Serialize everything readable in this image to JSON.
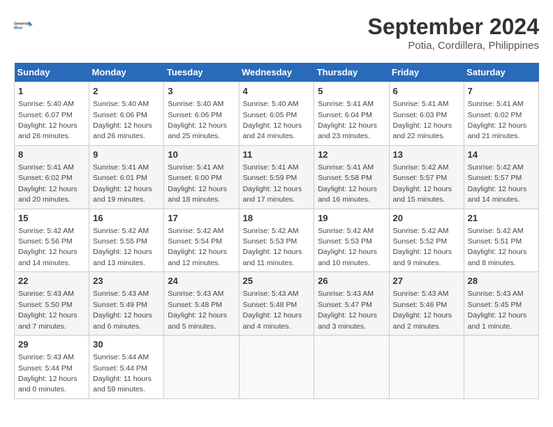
{
  "logo": {
    "line1": "General",
    "line2": "Blue"
  },
  "title": "September 2024",
  "location": "Potia, Cordillera, Philippines",
  "weekdays": [
    "Sunday",
    "Monday",
    "Tuesday",
    "Wednesday",
    "Thursday",
    "Friday",
    "Saturday"
  ],
  "weeks": [
    [
      {
        "day": "1",
        "info": "Sunrise: 5:40 AM\nSunset: 6:07 PM\nDaylight: 12 hours\nand 26 minutes."
      },
      {
        "day": "2",
        "info": "Sunrise: 5:40 AM\nSunset: 6:06 PM\nDaylight: 12 hours\nand 26 minutes."
      },
      {
        "day": "3",
        "info": "Sunrise: 5:40 AM\nSunset: 6:06 PM\nDaylight: 12 hours\nand 25 minutes."
      },
      {
        "day": "4",
        "info": "Sunrise: 5:40 AM\nSunset: 6:05 PM\nDaylight: 12 hours\nand 24 minutes."
      },
      {
        "day": "5",
        "info": "Sunrise: 5:41 AM\nSunset: 6:04 PM\nDaylight: 12 hours\nand 23 minutes."
      },
      {
        "day": "6",
        "info": "Sunrise: 5:41 AM\nSunset: 6:03 PM\nDaylight: 12 hours\nand 22 minutes."
      },
      {
        "day": "7",
        "info": "Sunrise: 5:41 AM\nSunset: 6:02 PM\nDaylight: 12 hours\nand 21 minutes."
      }
    ],
    [
      {
        "day": "8",
        "info": "Sunrise: 5:41 AM\nSunset: 6:02 PM\nDaylight: 12 hours\nand 20 minutes."
      },
      {
        "day": "9",
        "info": "Sunrise: 5:41 AM\nSunset: 6:01 PM\nDaylight: 12 hours\nand 19 minutes."
      },
      {
        "day": "10",
        "info": "Sunrise: 5:41 AM\nSunset: 6:00 PM\nDaylight: 12 hours\nand 18 minutes."
      },
      {
        "day": "11",
        "info": "Sunrise: 5:41 AM\nSunset: 5:59 PM\nDaylight: 12 hours\nand 17 minutes."
      },
      {
        "day": "12",
        "info": "Sunrise: 5:41 AM\nSunset: 5:58 PM\nDaylight: 12 hours\nand 16 minutes."
      },
      {
        "day": "13",
        "info": "Sunrise: 5:42 AM\nSunset: 5:57 PM\nDaylight: 12 hours\nand 15 minutes."
      },
      {
        "day": "14",
        "info": "Sunrise: 5:42 AM\nSunset: 5:57 PM\nDaylight: 12 hours\nand 14 minutes."
      }
    ],
    [
      {
        "day": "15",
        "info": "Sunrise: 5:42 AM\nSunset: 5:56 PM\nDaylight: 12 hours\nand 14 minutes."
      },
      {
        "day": "16",
        "info": "Sunrise: 5:42 AM\nSunset: 5:55 PM\nDaylight: 12 hours\nand 13 minutes."
      },
      {
        "day": "17",
        "info": "Sunrise: 5:42 AM\nSunset: 5:54 PM\nDaylight: 12 hours\nand 12 minutes."
      },
      {
        "day": "18",
        "info": "Sunrise: 5:42 AM\nSunset: 5:53 PM\nDaylight: 12 hours\nand 11 minutes."
      },
      {
        "day": "19",
        "info": "Sunrise: 5:42 AM\nSunset: 5:53 PM\nDaylight: 12 hours\nand 10 minutes."
      },
      {
        "day": "20",
        "info": "Sunrise: 5:42 AM\nSunset: 5:52 PM\nDaylight: 12 hours\nand 9 minutes."
      },
      {
        "day": "21",
        "info": "Sunrise: 5:42 AM\nSunset: 5:51 PM\nDaylight: 12 hours\nand 8 minutes."
      }
    ],
    [
      {
        "day": "22",
        "info": "Sunrise: 5:43 AM\nSunset: 5:50 PM\nDaylight: 12 hours\nand 7 minutes."
      },
      {
        "day": "23",
        "info": "Sunrise: 5:43 AM\nSunset: 5:49 PM\nDaylight: 12 hours\nand 6 minutes."
      },
      {
        "day": "24",
        "info": "Sunrise: 5:43 AM\nSunset: 5:48 PM\nDaylight: 12 hours\nand 5 minutes."
      },
      {
        "day": "25",
        "info": "Sunrise: 5:43 AM\nSunset: 5:48 PM\nDaylight: 12 hours\nand 4 minutes."
      },
      {
        "day": "26",
        "info": "Sunrise: 5:43 AM\nSunset: 5:47 PM\nDaylight: 12 hours\nand 3 minutes."
      },
      {
        "day": "27",
        "info": "Sunrise: 5:43 AM\nSunset: 5:46 PM\nDaylight: 12 hours\nand 2 minutes."
      },
      {
        "day": "28",
        "info": "Sunrise: 5:43 AM\nSunset: 5:45 PM\nDaylight: 12 hours\nand 1 minute."
      }
    ],
    [
      {
        "day": "29",
        "info": "Sunrise: 5:43 AM\nSunset: 5:44 PM\nDaylight: 12 hours\nand 0 minutes."
      },
      {
        "day": "30",
        "info": "Sunrise: 5:44 AM\nSunset: 5:44 PM\nDaylight: 11 hours\nand 59 minutes."
      },
      {
        "day": "",
        "info": ""
      },
      {
        "day": "",
        "info": ""
      },
      {
        "day": "",
        "info": ""
      },
      {
        "day": "",
        "info": ""
      },
      {
        "day": "",
        "info": ""
      }
    ]
  ]
}
